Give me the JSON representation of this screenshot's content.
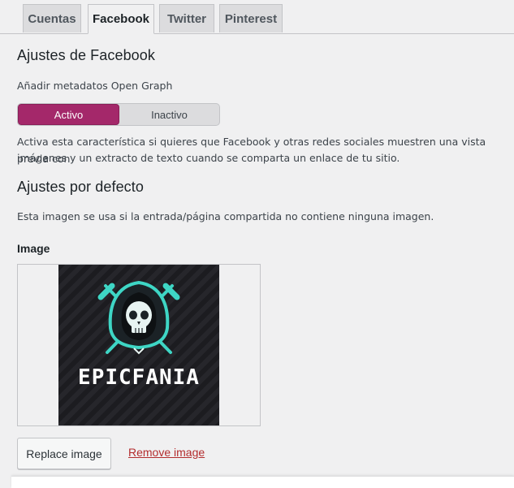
{
  "tabs": [
    {
      "label": "Cuentas"
    },
    {
      "label": "Facebook"
    },
    {
      "label": "Twitter"
    },
    {
      "label": "Pinterest"
    }
  ],
  "active_tab": "Facebook",
  "facebook": {
    "heading": "Ajustes de Facebook",
    "og_label": "Añadir metadatos Open Graph",
    "toggle": {
      "on_label": "Activo",
      "off_label": "Inactivo",
      "selected": "Activo"
    },
    "description_line1": "Activa esta característica si quieres que Facebook y otras redes sociales muestren una vista previa con",
    "description_line2": "imágenes y un extracto de texto cuando se comparta un enlace de tu sitio."
  },
  "defaults": {
    "heading": "Ajustes por defecto",
    "description": "Esta imagen se usa si la entrada/página compartida no contiene ninguna imagen.",
    "image_label": "Image",
    "image_logo_text": "EPICFANIA",
    "replace_label": "Replace image",
    "remove_label": "Remove image"
  },
  "colors": {
    "accent": "#a4286a",
    "remove_link": "#b32d2e",
    "logo_teal": "#3ed6c5"
  }
}
